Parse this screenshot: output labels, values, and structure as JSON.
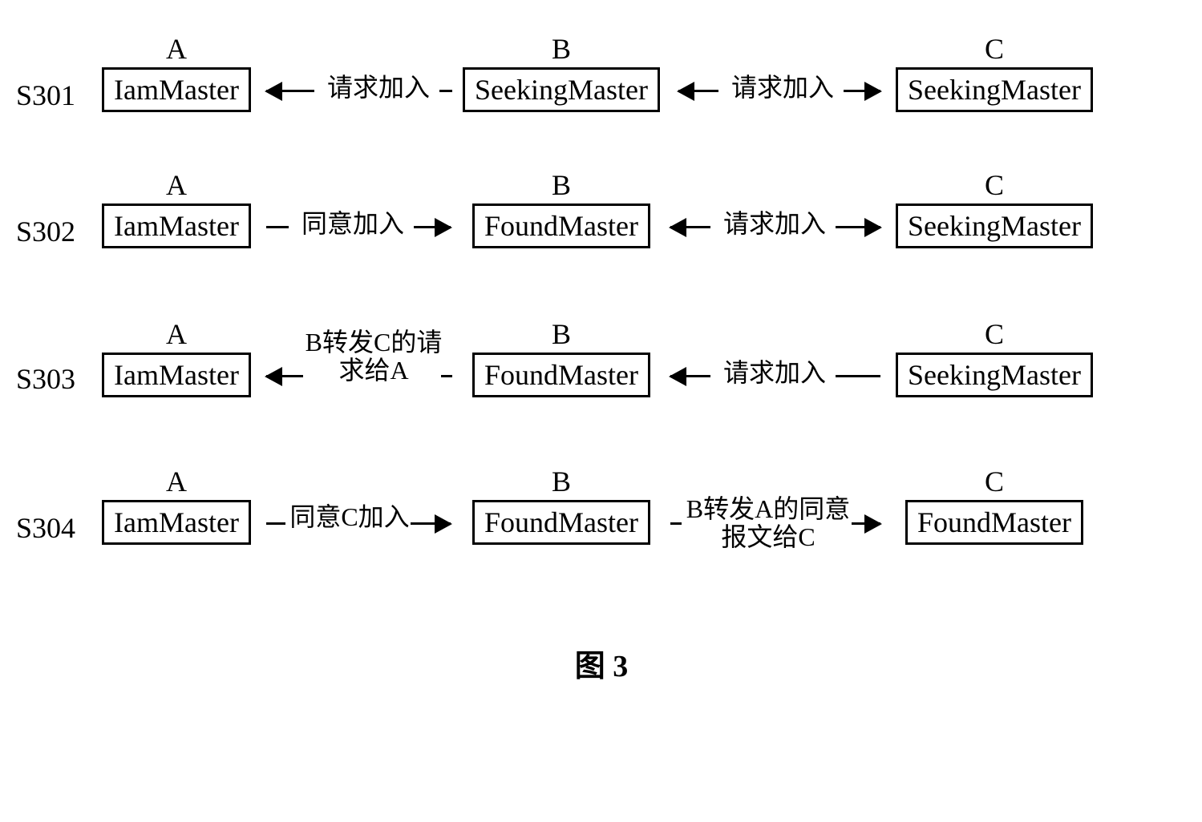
{
  "caption": "图 3",
  "labels": {
    "A": "A",
    "B": "B",
    "C": "C"
  },
  "steps": {
    "s301": {
      "id": "S301",
      "nodeA": "IamMaster",
      "nodeB": "SeekingMaster",
      "nodeC": "SeekingMaster",
      "msgAB": "请求加入",
      "msgBC": "请求加入"
    },
    "s302": {
      "id": "S302",
      "nodeA": "IamMaster",
      "nodeB": "FoundMaster",
      "nodeC": "SeekingMaster",
      "msgAB": "同意加入",
      "msgBC": "请求加入"
    },
    "s303": {
      "id": "S303",
      "nodeA": "IamMaster",
      "nodeB": "FoundMaster",
      "nodeC": "SeekingMaster",
      "msgAB": "B转发C的请求给A",
      "msgBC": "请求加入"
    },
    "s304": {
      "id": "S304",
      "nodeA": "IamMaster",
      "nodeB": "FoundMaster",
      "nodeC": "FoundMaster",
      "msgAB": "同意C加入",
      "msgBC": "B转发A的同意报文给C"
    }
  }
}
